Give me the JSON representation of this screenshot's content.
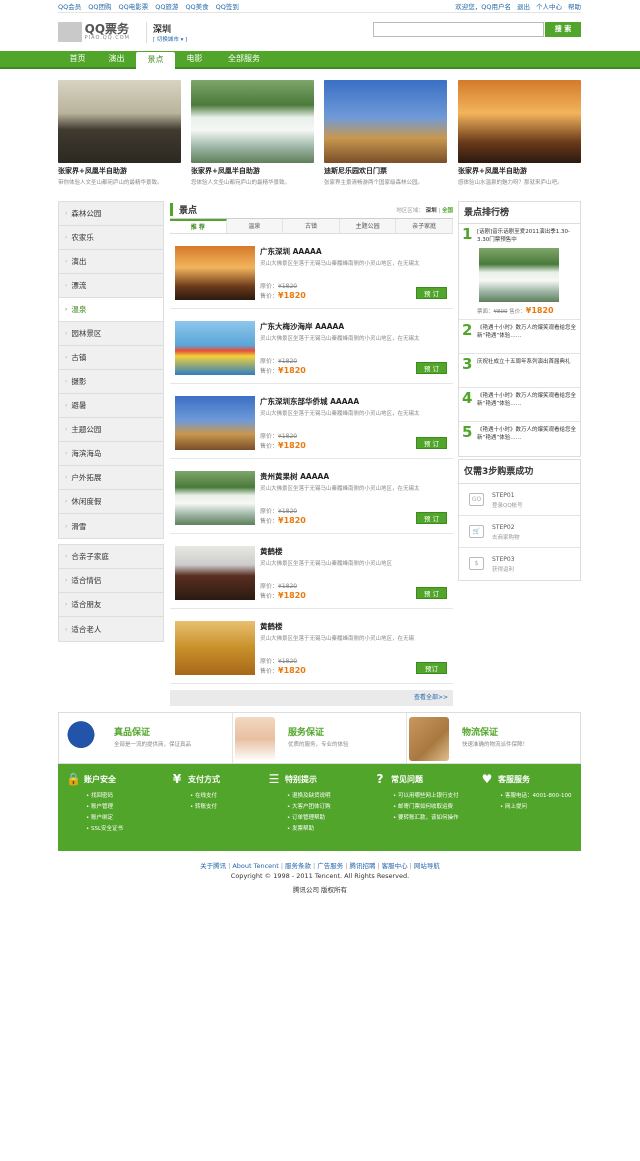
{
  "topbar": {
    "left_links": [
      "QQ会员",
      "QQ团购",
      "QQ电影票",
      "QQ旅游",
      "QQ美食",
      "QQ签到"
    ],
    "right_links": [
      "欢迎您，QQ用户名",
      "退出",
      "个人中心",
      "帮助"
    ]
  },
  "header": {
    "logo_title": "QQ票务",
    "logo_sub": "PIAO.QQ.COM",
    "city": "深圳",
    "city_switch": "[ 切换城市 ▾ ]",
    "search_placeholder": "",
    "search_button": "搜 索"
  },
  "nav": [
    "首页",
    "演出",
    "景点",
    "电影",
    "全部服务"
  ],
  "featured": [
    {
      "title": "张家界+凤凰半自助游",
      "desc": "带你体验人文圣山都宛庐山的最精华景致。"
    },
    {
      "title": "张家界+凤凰半自助游",
      "desc": "您体验人文圣山都宛庐山的最精华景致。"
    },
    {
      "title": "迪斯尼乐园欢日门票",
      "desc": "张家界主景清畅游两个国家级森林公园。"
    },
    {
      "title": "张家界+凤凰半自助游",
      "desc": "感体验山水温泉的魅力呀？那就来庐山吧。"
    }
  ],
  "sidebar": {
    "group1": [
      "森林公园",
      "农家乐",
      "演出",
      "漂流",
      "温泉",
      "园林景区",
      "古镇",
      "摄影",
      "避暑",
      "主题公园",
      "海滨海岛",
      "户外拓展",
      "休闲度假",
      "滑雪"
    ],
    "group2": [
      "合亲子家庭",
      "适合情侣",
      "适合朋友",
      "适合老人"
    ],
    "active": "温泉"
  },
  "main": {
    "title": "景点",
    "filter_label": "地区区域：",
    "filter_city": "深圳",
    "filter_sep": "|",
    "filter_all": "全国",
    "tabs": [
      "推 荐",
      "温泉",
      "古镇",
      "主题公园",
      "亲子家庭"
    ],
    "items": [
      {
        "title": "广东深圳  AAAAA",
        "desc": "灵山大佛景区坐落于无锡马山秦履峰南侧的小灵山地区，在无锡太",
        "orig_label": "原价：",
        "orig": "¥1820",
        "price_label": "售价：",
        "price": "¥1820",
        "btn": "预 订"
      },
      {
        "title": "广东大梅沙海岸  AAAAA",
        "desc": "灵山大佛景区坐落于无锡马山秦履峰南侧的小灵山地区，在无锡太",
        "orig_label": "原价：",
        "orig": "¥1820",
        "price_label": "售价：",
        "price": "¥1820",
        "btn": "预 订"
      },
      {
        "title": "广东深圳东部华侨城  AAAAA",
        "desc": "灵山大佛景区坐落于无锡马山秦履峰南侧的小灵山地区，在无锡太",
        "orig_label": "原价：",
        "orig": "¥1820",
        "price_label": "售价：",
        "price": "¥1820",
        "btn": "预 订"
      },
      {
        "title": "贵州黄果树  AAAAA",
        "desc": "灵山大佛景区坐落于无锡马山秦履峰南侧的小灵山地区，在无锡太",
        "orig_label": "原价：",
        "orig": "¥1820",
        "price_label": "售价：",
        "price": "¥1820",
        "btn": "预 订"
      },
      {
        "title": "黄鹤楼",
        "desc": "灵山大佛景区坐落于无锡马山秦履峰南侧的小灵山地区",
        "orig_label": "原价：",
        "orig": "¥1820",
        "price_label": "售价：",
        "price": "¥1820",
        "btn": "预 订"
      },
      {
        "title": "黄鹤楼",
        "desc": "灵山大佛景区坐落于无锡马山秦履峰南侧的小灵山地区，在无锡",
        "orig_label": "原价：",
        "orig": "¥1820",
        "price_label": "售价：",
        "price": "¥1820",
        "btn": "预订"
      }
    ],
    "more": "查看全部>>"
  },
  "ranking": {
    "title": "景点排行榜",
    "first": {
      "num": "1",
      "text": "[话剧]音乐话剧至爱2011演出季1.30-3.30门票预售中",
      "orig_label": "票面：",
      "orig": "¥800",
      "price_label": "售价：",
      "price": "¥1820"
    },
    "items": [
      {
        "num": "2",
        "text": "《艳遇十小时》数万人的爆笑观看给您全新“艳遇”体验……"
      },
      {
        "num": "3",
        "text": "庆祝社成立十五周年系列演出首届典礼"
      },
      {
        "num": "4",
        "text": "《艳遇十小时》数万人的爆笑观看给您全新“艳遇”体验……"
      },
      {
        "num": "5",
        "text": "《艳遇十小时》数万人的爆笑观看给您全新“艳遇”体验……"
      }
    ]
  },
  "steps": {
    "title": "仅需3步购票成功",
    "items": [
      {
        "icon": "GO",
        "step": "STEP01",
        "desc": "登录QQ帐号"
      },
      {
        "icon": "🛒",
        "step": "STEP02",
        "desc": "去商家购物"
      },
      {
        "icon": "$",
        "step": "STEP03",
        "desc": "获得返利"
      }
    ]
  },
  "guarantee": [
    {
      "title": "真品保证",
      "desc": "全部是一流的提供商，保证真品"
    },
    {
      "title": "服务保证",
      "desc": "优质的服务，专业的体验"
    },
    {
      "title": "物流保证",
      "desc": "快速准确的物流派件保障！"
    }
  ],
  "footer": [
    {
      "icon": "🔒",
      "title": "账户安全",
      "items": [
        "找回密码",
        "账户管理",
        "账户绑定",
        "SSL安全证书"
      ]
    },
    {
      "icon": "¥",
      "title": "支付方式",
      "items": [
        "在线支付",
        "转账支付"
      ]
    },
    {
      "icon": "☰",
      "title": "特别提示",
      "items": [
        "退换及缺货说明",
        "大客户团体订购",
        "订单管理帮助",
        "发票帮助"
      ]
    },
    {
      "icon": "?",
      "title": "常见问题",
      "items": [
        "可以用哪些网上银行支付",
        "邮寄门票如何收取运费",
        "要转账汇款，该如何操作"
      ]
    },
    {
      "icon": "♥",
      "title": "客服服务",
      "items": [
        "客服电话：4001-800-100",
        "网上提问"
      ]
    }
  ],
  "links": [
    "关于腾讯",
    "About Tencent",
    "服务条款",
    "广告服务",
    "腾讯招聘",
    "客服中心",
    "网站导航"
  ],
  "copyright": "Copyright © 1998 - 2011 Tencent. All Rights Reserved.",
  "company": "腾讯公司 版权所有",
  "colors": {
    "accent": "#52a52b",
    "price": "#e87a10",
    "link": "#2266aa"
  }
}
